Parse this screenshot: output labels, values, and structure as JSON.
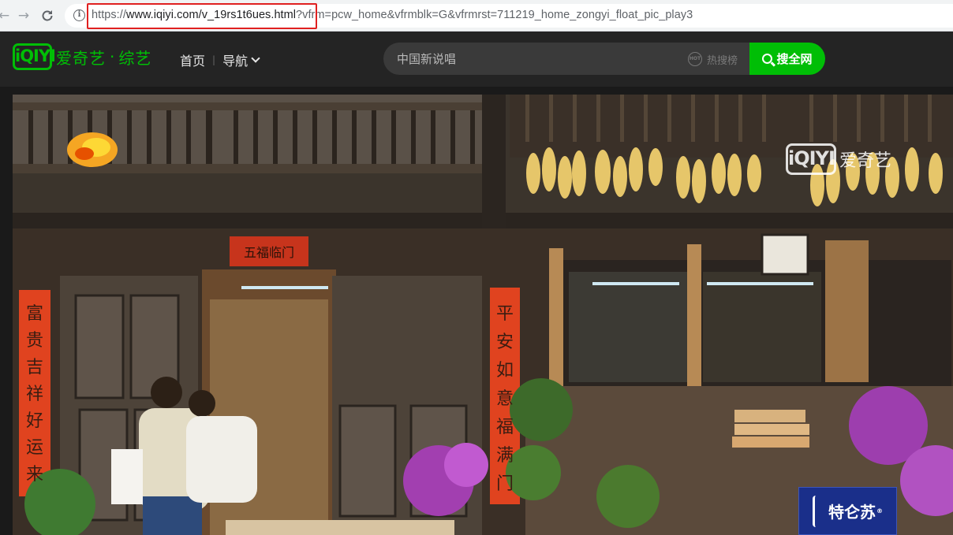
{
  "browser": {
    "url_scheme": "https://",
    "url_host": "www.iqiyi.com",
    "url_path": "/v_19rs1t6ues.html",
    "url_query": "?vfrm=pcw_home&vfrmblk=G&vfrmrst=711219_home_zongyi_float_pic_play3",
    "info_icon": "i"
  },
  "header": {
    "logo_mark": "iQIYI",
    "logo_text": "爱奇艺",
    "logo_sep": "·",
    "logo_channel": "综艺",
    "nav_home": "首页",
    "nav_divider": "|",
    "nav_guide": "导航"
  },
  "search": {
    "placeholder": "中国新说唱",
    "hot_icon": "HOT",
    "hot_label": "热搜榜",
    "button_label": "搜全网"
  },
  "video": {
    "watermark_mark": "iQIYI",
    "watermark_text": "爱奇艺",
    "sponsor_text": "特仑苏",
    "sponsor_mark": "®",
    "sign_top": "五福临门",
    "couplet_left": "富贵吉祥好运来",
    "couplet_right": "平安如意福满门"
  },
  "colors": {
    "brand_green": "#00be06",
    "header_bg": "#242424",
    "highlight_red": "#e02020"
  }
}
